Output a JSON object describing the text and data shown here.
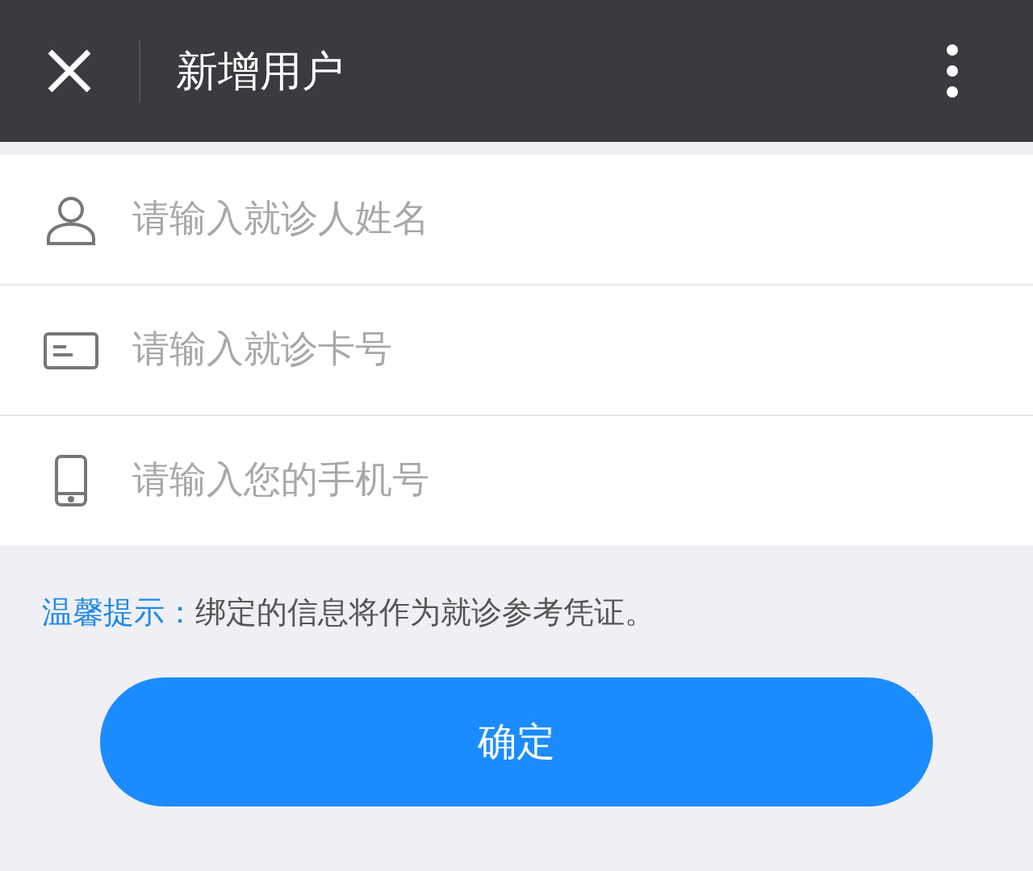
{
  "header": {
    "title": "新增用户"
  },
  "fields": [
    {
      "kind": "person",
      "placeholder": "请输入就诊人姓名"
    },
    {
      "kind": "card",
      "placeholder": "请输入就诊卡号"
    },
    {
      "kind": "phone",
      "placeholder": "请输入您的手机号"
    }
  ],
  "tip": {
    "label": "温馨提示：",
    "text": "绑定的信息将作为就诊参考凭证。"
  },
  "buttons": [
    "确定"
  ]
}
